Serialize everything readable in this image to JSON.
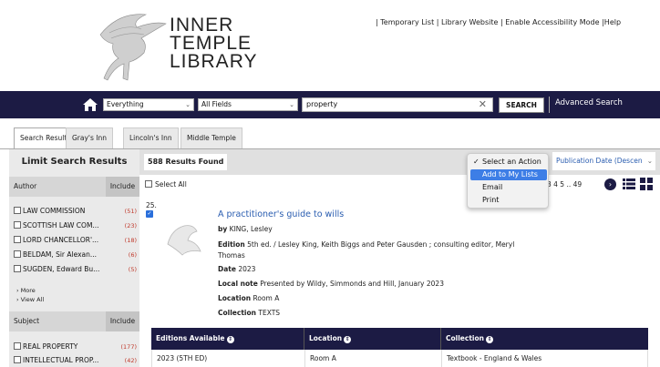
{
  "header": {
    "logo_lines": [
      "INNER",
      "TEMPLE",
      "LIBRARY"
    ],
    "top_links": [
      "Temporary List",
      "Library Website",
      "Enable Accessibility Mode",
      "Help"
    ]
  },
  "search": {
    "scope": "Everything",
    "field": "All Fields",
    "query": "property",
    "search_button": "SEARCH",
    "advanced": "Advanced Search"
  },
  "tabs": [
    {
      "label": "Search Results",
      "active": true
    },
    {
      "label": "Gray's Inn",
      "active": false
    },
    {
      "label": "Lincoln's Inn",
      "active": false
    },
    {
      "label": "Middle Temple",
      "active": false
    }
  ],
  "sidebar": {
    "title": "Limit Search Results",
    "author": {
      "label": "Author",
      "include": "Include",
      "items": [
        {
          "label": "LAW COMMISSION",
          "count": "(51)"
        },
        {
          "label": "SCOTTISH LAW COM...",
          "count": "(23)"
        },
        {
          "label": "LORD CHANCELLOR'...",
          "count": "(18)"
        },
        {
          "label": "BELDAM, Sir Alexan...",
          "count": "(6)"
        },
        {
          "label": "SUGDEN, Edward Bu...",
          "count": "(5)"
        }
      ],
      "more": "More",
      "view_all": "View All"
    },
    "subject": {
      "label": "Subject",
      "include": "Include",
      "items": [
        {
          "label": "REAL PROPERTY",
          "count": "(177)"
        },
        {
          "label": "INTELLECTUAL PROP...",
          "count": "(42)"
        }
      ]
    }
  },
  "results": {
    "found": "588 Results Found",
    "sort": "Publication Date (Descen",
    "select_all": "Select All",
    "pager": "3 4 5 .. 49"
  },
  "action_menu": {
    "items": [
      {
        "label": "Select an Action",
        "checked": true,
        "highlighted": false
      },
      {
        "label": "Add to My Lists",
        "checked": false,
        "highlighted": true
      },
      {
        "label": "Email",
        "checked": false,
        "highlighted": false
      },
      {
        "label": "Print",
        "checked": false,
        "highlighted": false
      }
    ]
  },
  "record": {
    "number": "25.",
    "title": "A practitioner's guide to wills",
    "by_label": "by",
    "by": "KING, Lesley",
    "edition_label": "Edition",
    "edition_line1": "5th ed. / Lesley King, Keith Biggs and Peter Gausden ; consulting editor, Meryl",
    "edition_line2": "Thomas",
    "date_label": "Date",
    "date": "2023",
    "local_note_label": "Local note",
    "local_note": "Presented by Wildy, Simmonds and Hill, January 2023",
    "location_label": "Location",
    "location": "Room A",
    "collection_label": "Collection",
    "collection": "TEXTS"
  },
  "editions": {
    "headers": [
      "Editions Available",
      "Location",
      "Collection"
    ],
    "row": [
      "2023 (5TH ED)",
      "Room A",
      "Textbook - England & Wales"
    ]
  },
  "colors": {
    "navy": "#1c1b44",
    "link_blue": "#2a5db0",
    "count_red": "#c0392b",
    "highlight": "#3d7ee6"
  }
}
